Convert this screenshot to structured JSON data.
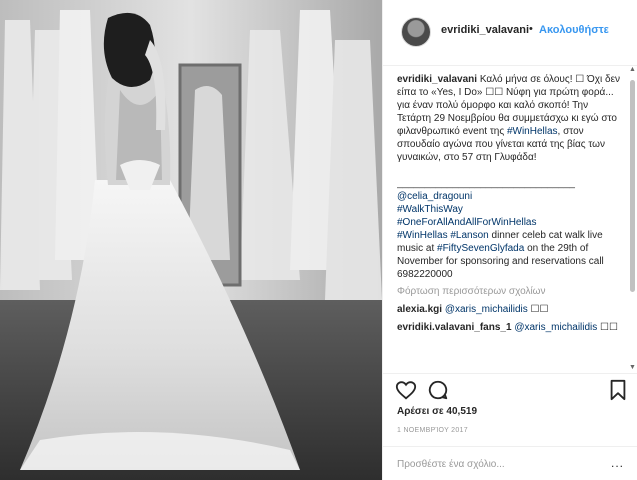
{
  "header": {
    "username": "evridiki_valavani",
    "separator": "•",
    "follow_label": "Ακολουθήστε"
  },
  "caption": {
    "username": "evridiki_valavani",
    "text_part1": "Καλό μήνα σε όλους! ☐ Όχι δεν είπα το «Yes, I Do» ☐☐ Νύφη για πρώτη φορά... για έναν πολύ όμορφο και καλό σκοπό! Την Τετάρτη 29 Νοεμβρίου θα συμμετάσχω κι εγώ στο φιλανθρωπικό event της",
    "hashtag_winhellas": "#WinHellas",
    "text_part2": ", στον σπουδαίο αγώνα που γίνεται κατά της βίας των γυναικών, στο 57 στη Γλυφάδα!",
    "divider": "________________________________",
    "mention_celia": "@celia_dragouni",
    "hashtag_walk": "#WalkThisWay",
    "hashtag_oneforall": "#OneForAllAndAllForWinHellas",
    "hashtag_winhellas2": "#WinHellas",
    "hashtag_lanson": "#Lanson",
    "text_part3": "dinner celeb cat walk live music at",
    "hashtag_fiftyseven": "#FiftySevenGlyfada",
    "text_part4": "on the 29th of November for sponsoring and reservations call 6982220000"
  },
  "load_more_label": "Φόρτωση περισσότερων σχολίων",
  "comments": [
    {
      "username": "alexia.kgi",
      "mention": "@xaris_michailidis",
      "text": "☐☐"
    },
    {
      "username": "evridiki.valavani_fans_1",
      "mention": "@xaris_michailidis",
      "text": "☐☐"
    }
  ],
  "actions": {
    "like_icon": "heart-icon",
    "comment_icon": "comment-bubble-icon",
    "save_icon": "bookmark-icon"
  },
  "likes_text": "Αρέσει σε 40,519",
  "date_text": "1 ΝΟΕΜΒΡΊΟΥ 2017",
  "add_comment_placeholder": "Προσθέστε ένα σχόλιο...",
  "more_options": "...",
  "scrollbar": {
    "up_arrow": "▲",
    "down_arrow": "▼"
  },
  "colors": {
    "link_blue": "#3897f0",
    "hashtag_blue": "#003569",
    "muted": "#999999"
  }
}
